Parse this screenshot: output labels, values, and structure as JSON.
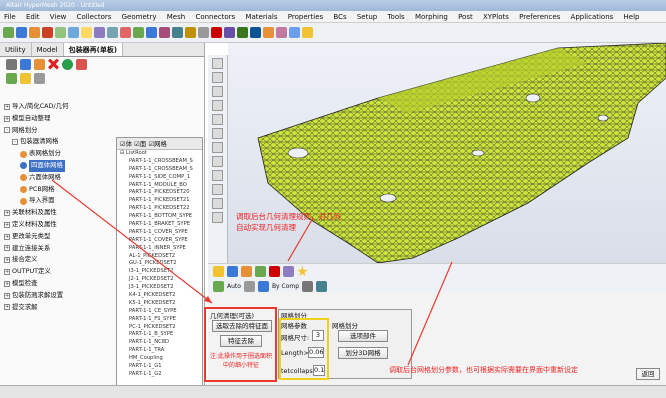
{
  "title_bar": {
    "text": "Altair HyperMesh 2020 - Untitled"
  },
  "menu": [
    "File",
    "Edit",
    "View",
    "Collectors",
    "Geometry",
    "Mesh",
    "Connectors",
    "Materials",
    "Properties",
    "BCs",
    "Setup",
    "Tools",
    "Morphing",
    "Post",
    "XYPlots",
    "Preferences",
    "Applications",
    "Help"
  ],
  "tabs": [
    "Utility",
    "Model",
    "包装器再(单板)"
  ],
  "tree": [
    {
      "label": "导入/简化CAD/几何",
      "level": 0,
      "expander": "+"
    },
    {
      "label": "模型自动整理",
      "level": 0,
      "expander": "+"
    },
    {
      "label": "网格划分",
      "level": 0,
      "expander": "-"
    },
    {
      "label": "包装器清网格",
      "level": 1,
      "expander": "-"
    },
    {
      "label": "表网格划分",
      "level": 2,
      "expander": ""
    },
    {
      "label": "四面体网格",
      "level": 2,
      "expander": "",
      "selected": true
    },
    {
      "label": "六面体网格",
      "level": 2,
      "expander": ""
    },
    {
      "label": "PCB网格",
      "level": 2,
      "expander": ""
    },
    {
      "label": "导入界面",
      "level": 2,
      "expander": ""
    },
    {
      "label": "关联材料及属性",
      "level": 0,
      "expander": "+"
    },
    {
      "label": "定义材料及属性",
      "level": 0,
      "expander": "+"
    },
    {
      "label": "更改单元类型",
      "level": 0,
      "expander": "+"
    },
    {
      "label": "建立连接关系",
      "level": 0,
      "expander": "+"
    },
    {
      "label": "接合定义",
      "level": 0,
      "expander": "+"
    },
    {
      "label": "OUTPUT定义",
      "level": 0,
      "expander": "+"
    },
    {
      "label": "模型检查",
      "level": 0,
      "expander": "+"
    },
    {
      "label": "包装防溅求解设置",
      "level": 0,
      "expander": "+"
    },
    {
      "label": "提交求解",
      "level": 0,
      "expander": "+"
    }
  ],
  "list_panel": {
    "header_checks": [
      "体",
      "面",
      "网格"
    ],
    "root": "ListRoot",
    "items": [
      "PART-1-1_CROSSBEAM_S",
      "PART-1-1_CROSSBEAM_S",
      "PART-1-1_SIDE_COMP_1",
      "PART-1-1_MODULE_BO",
      "PART-1-1_PICKEDSET20",
      "PART-1-1_PICKEDSET21",
      "PART-1-1_PICKEDSET22",
      "PART-1-1_BOTTOM_SYPE",
      "PART-1-1_BRAKET_SYPE",
      "PART-1-1_COVER_SYPE",
      "PART-1-1_COVER_SYPE",
      "PART-1-1_INNER_SYPE",
      "AL-1_PICKEDSET2",
      "GU-1_PICKEDSET2",
      "I3-1_PICKEDSET2",
      "J2-1_PICKEDSET2",
      "J3-1_PICKEDSET2",
      "K4-1_PICKEDSET2",
      "K5-1_PICKEDSET2",
      "PART-1-1_CE_SYPE",
      "PART-1-1_FS_SYPE",
      "PC-1_PICKEDSET2",
      "PART-1-1_B_SYPE",
      "PART-1-1_NC8D",
      "PART-1-1_TRA",
      "HM_Coupling",
      "PART-1-1_G1",
      "PART-1-1_G2"
    ]
  },
  "annotations": {
    "viewport_note": "调取后台几何清理规则，对几何自动实现几何清理",
    "mesh_note": "调取后台网格划分参数，也可根据实际需要在界面中重新设定",
    "clean_note": "注:此操作用于圈选面积中的细小特征"
  },
  "bottom_toolbar": {
    "auto_label": "Auto",
    "bycomp_label": "By Comp"
  },
  "geom_panel": {
    "title": "几何清理(可选)",
    "extract_button": "选取去除的特征面",
    "clean_button": "特征去除"
  },
  "mesh_panel": {
    "title": "网格划分",
    "params_title": "网格参数",
    "fields": [
      {
        "label": "网格尺寸:",
        "value": "3"
      },
      {
        "label": "Length>",
        "value": "0.06"
      },
      {
        "label": "tetcollaps",
        "value": "0.1"
      }
    ],
    "sub_title": "网格划分",
    "select_button": "选项部件",
    "mesh3d_button": "划分3D网格"
  },
  "return_button": "返回",
  "colors": {
    "mesh": "#cde63a",
    "highlight": "#e83a2f",
    "frame_yellow": "#f0d01e",
    "selection": "#3d6fc4"
  }
}
